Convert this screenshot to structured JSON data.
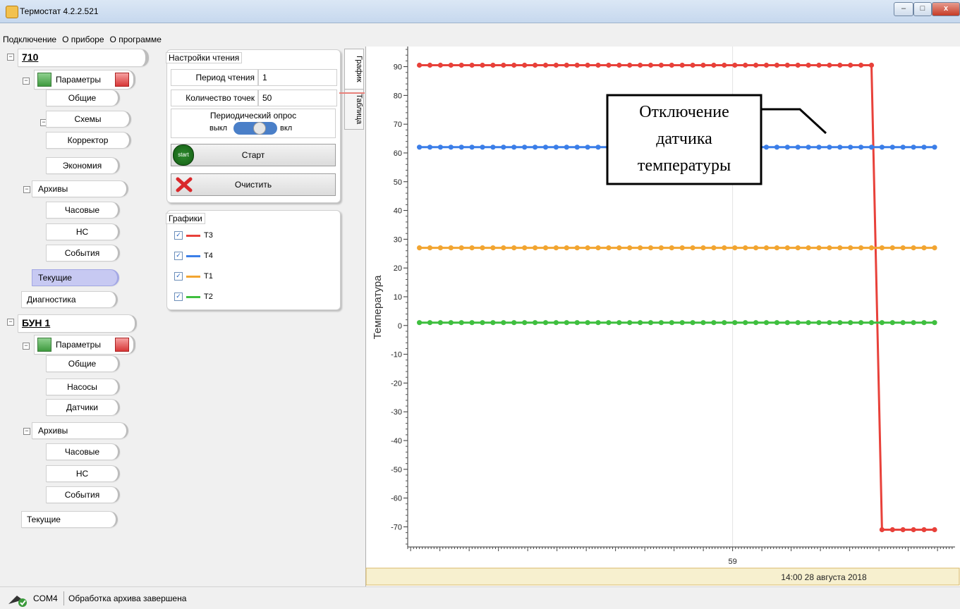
{
  "window": {
    "title": "Термостат 4.2.2.521"
  },
  "menu": [
    "Подключение",
    "О приборе",
    "О программе"
  ],
  "tree": {
    "device1": {
      "name": "710",
      "params_label": "Параметры",
      "obshie": "Общие",
      "schemes": "Схемы",
      "corrector": "Корректор",
      "economy": "Экономия",
      "archives": "Архивы",
      "hourly": "Часовые",
      "ns": "НС",
      "events": "События",
      "current": "Текущие",
      "diagnostics": "Диагностика"
    },
    "device2": {
      "name": "БУН 1",
      "params_label": "Параметры",
      "obshie": "Общие",
      "pumps": "Насосы",
      "sensors": "Датчики",
      "archives": "Архивы",
      "hourly": "Часовые",
      "ns": "НС",
      "events": "События",
      "current": "Текущие"
    }
  },
  "read_settings": {
    "title": "Настройки чтения",
    "period_label": "Период чтения",
    "period_value": "1",
    "points_label": "Количество точек",
    "points_value": "50",
    "periodic_label": "Периодический опрос",
    "off_label": "выкл",
    "on_label": "вкл",
    "start_icon_label": "start",
    "start_label": "Старт",
    "clear_label": "Очистить"
  },
  "graphs_panel": {
    "title": "Графики",
    "items": [
      {
        "label": "T3",
        "color": "#e8413a",
        "checked": true
      },
      {
        "label": "T4",
        "color": "#3b7ee8",
        "checked": true
      },
      {
        "label": "T1",
        "color": "#f2a531",
        "checked": true
      },
      {
        "label": "T2",
        "color": "#3fbf3f",
        "checked": true
      }
    ]
  },
  "view_tabs": {
    "graph": "График",
    "table": "Таблица"
  },
  "annotation": {
    "lines": [
      "Отключение",
      "датчика",
      "температуры"
    ]
  },
  "chart_data": {
    "type": "line",
    "ylabel": "Температура",
    "xlabel": "",
    "ylim": [
      -77,
      97
    ],
    "xlim": [
      47.9,
      66.6
    ],
    "y_ticks": [
      90,
      80,
      70,
      60,
      50,
      40,
      30,
      20,
      10,
      0,
      -10,
      -20,
      -30,
      -40,
      -50,
      -60,
      -70
    ],
    "x_tick_label": "59",
    "x_caption": "14:00 28 августа 2018",
    "grid": true,
    "series": [
      {
        "name": "T3",
        "color": "#e8413a",
        "x_from": 48.3,
        "x_to": 65.9,
        "drop_at": 63.9,
        "value_before": 90.5,
        "value_after": -71
      },
      {
        "name": "T4",
        "color": "#3b7ee8",
        "x_from": 48.3,
        "x_to": 65.9,
        "value": 62
      },
      {
        "name": "T1",
        "color": "#f2a531",
        "x_from": 48.3,
        "x_to": 65.9,
        "value": 27
      },
      {
        "name": "T2",
        "color": "#3fbf3f",
        "x_from": 48.3,
        "x_to": 65.9,
        "value": 1
      }
    ]
  },
  "status": {
    "port": "COM4",
    "message": "Обработка архива завершена"
  }
}
